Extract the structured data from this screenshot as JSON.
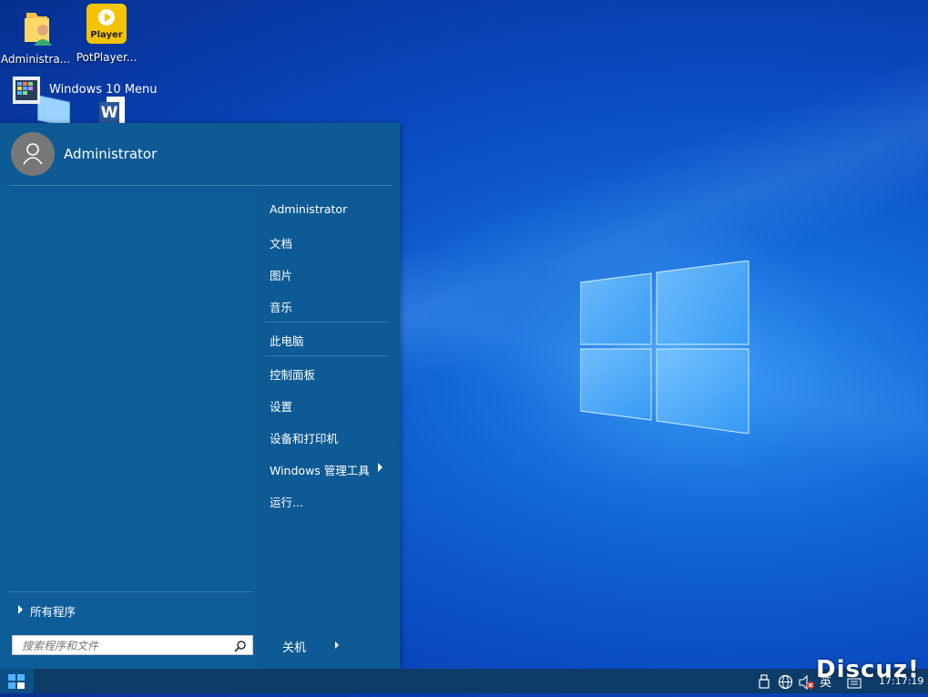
{
  "desktop": {
    "icons": [
      {
        "label": "Administra..."
      },
      {
        "label": "PotPlayer..."
      },
      {
        "label": ""
      },
      {
        "label": ""
      }
    ],
    "player_badge": "Player"
  },
  "start_menu": {
    "user": "Administrator",
    "pinned": [
      {
        "label": "Windows 10 Menu"
      }
    ],
    "right_items": [
      {
        "label": "Administrator"
      },
      {
        "label": "文档"
      },
      {
        "label": "图片"
      },
      {
        "label": "音乐"
      },
      {
        "label": "此电脑"
      },
      {
        "label": "控制面板"
      },
      {
        "label": "设置"
      },
      {
        "label": "设备和打印机"
      },
      {
        "label": "Windows 管理工具"
      },
      {
        "label": "运行..."
      }
    ],
    "all_programs": "所有程序",
    "search_placeholder": "搜索程序和文件",
    "shutdown": "关机"
  },
  "taskbar": {
    "ime": "英",
    "clock": "17:17:19"
  },
  "watermark": "Discuz!",
  "colors": {
    "menu_bg": "#0d5a94",
    "taskbar_bg": "#0d3c68",
    "desktop_accent": "#1166d6"
  }
}
